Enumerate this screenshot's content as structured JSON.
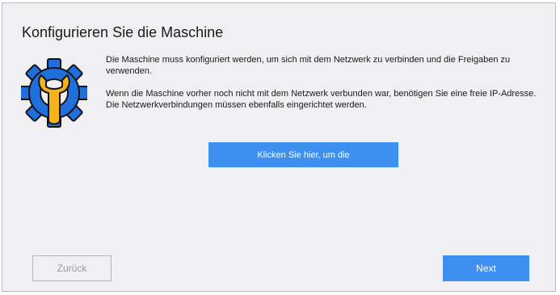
{
  "dialog": {
    "title": "Konfigurieren Sie die Maschine",
    "icon": "gear-wrench-icon",
    "paragraph1": "Die Maschine muss konfiguriert werden, um sich mit dem Netzwerk zu verbinden und die Freigaben zu verwenden.",
    "paragraph2_line1": "Wenn die Maschine vorher noch nicht mit dem Netzwerk verbunden war, benötigen Sie eine freie IP-Adresse.",
    "paragraph2_line2": "Die Netzwerkverbindungen müssen ebenfalls eingerichtet werden.",
    "configure_button_label": "Klicken Sie hier, um die"
  },
  "footer": {
    "back_label": "Zurück",
    "next_label": "Next"
  },
  "colors": {
    "accent": "#3d8ff0",
    "gear": "#1f6fdc",
    "wrench": "#f5b21a",
    "background": "#f0f0f3"
  }
}
